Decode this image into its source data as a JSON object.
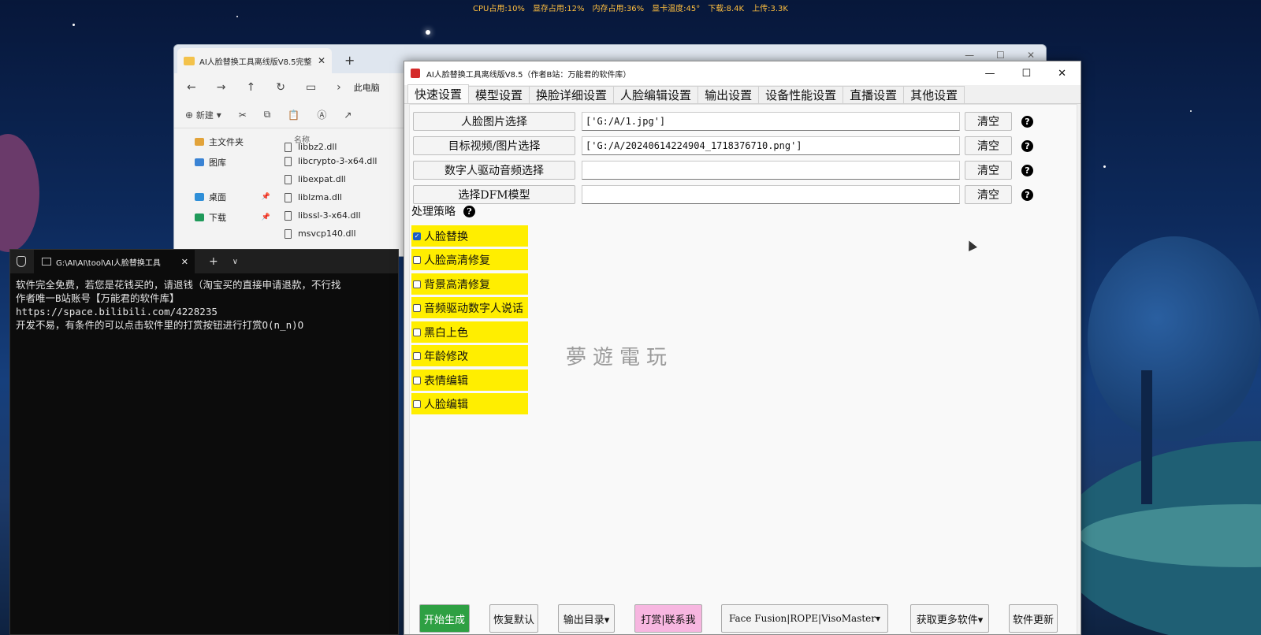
{
  "status_bar": {
    "cpu": "CPU占用:10%",
    "vram": "显存占用:12%",
    "ram": "内存占用:36%",
    "gpu_temp": "显卡温度:45°",
    "download": "下载:8.4K",
    "upload": "上传:3.3K"
  },
  "explorer": {
    "tab_title": "AI人脸替换工具离线版V8.5完整",
    "breadcrumb": "此电脑",
    "new_label": "新建",
    "sidebar": [
      "主文件夹",
      "图库",
      "桌面",
      "下载"
    ],
    "column_header": "名称",
    "files": [
      "libbz2.dll",
      "libcrypto-3-x64.dll",
      "libexpat.dll",
      "liblzma.dll",
      "libssl-3-x64.dll",
      "msvcp140.dll"
    ]
  },
  "terminal": {
    "tab_title": "G:\\AI\\AI\\tool\\AI人脸替换工具",
    "lines": [
      "软件完全免费，若您是花钱买的，请退钱（淘宝买的直接申请退款，不行找",
      "",
      "作者唯一B站账号【万能君的软件库】",
      "https://space.bilibili.com/4228235",
      "",
      "开发不易，有条件的可以点击软件里的打赏按钮进行打赏O(n_n)O"
    ]
  },
  "app": {
    "title": "AI人脸替换工具离线版V8.5（作者B站：万能君的软件库）",
    "tabs": [
      "快速设置",
      "模型设置",
      "换脸详细设置",
      "人脸编辑设置",
      "输出设置",
      "设备性能设置",
      "直播设置",
      "其他设置"
    ],
    "rows": [
      {
        "button": "人脸图片选择",
        "value": "['G:/A/1.jpg']"
      },
      {
        "button": "目标视频/图片选择",
        "value": "['G:/A/20240614224904_1718376710.png']"
      },
      {
        "button": "数字人驱动音频选择",
        "value": ""
      },
      {
        "button": "选择DFM模型",
        "value": ""
      }
    ],
    "clear_label": "清空",
    "help_label": "?",
    "strategy_label": "处理策略",
    "options": [
      {
        "label": "人脸替换",
        "checked": true
      },
      {
        "label": "人脸高清修复",
        "checked": false
      },
      {
        "label": "背景高清修复",
        "checked": false
      },
      {
        "label": "音频驱动数字人说话",
        "checked": false
      },
      {
        "label": "黑白上色",
        "checked": false
      },
      {
        "label": "年龄修改",
        "checked": false
      },
      {
        "label": "表情编辑",
        "checked": false
      },
      {
        "label": "人脸编辑",
        "checked": false
      }
    ],
    "watermark": "夢遊電玩",
    "bottom_buttons": [
      {
        "label": "开始生成",
        "color": "#2ea043"
      },
      {
        "label": "恢复默认",
        "color": "#f4f4f4"
      },
      {
        "label": "输出目录▾",
        "color": "#f4f4f4"
      },
      {
        "label": "打赏|联系我",
        "color": "#f7b6e0"
      },
      {
        "label": "Face Fusion|ROPE|VisoMaster▾",
        "color": "#f4f4f4"
      },
      {
        "label": "获取更多软件▾",
        "color": "#f4f4f4"
      },
      {
        "label": "软件更新",
        "color": "#f4f4f4"
      }
    ],
    "colors": {
      "highlight": "#ffee00",
      "checkbox": "#1a5fc7"
    }
  }
}
